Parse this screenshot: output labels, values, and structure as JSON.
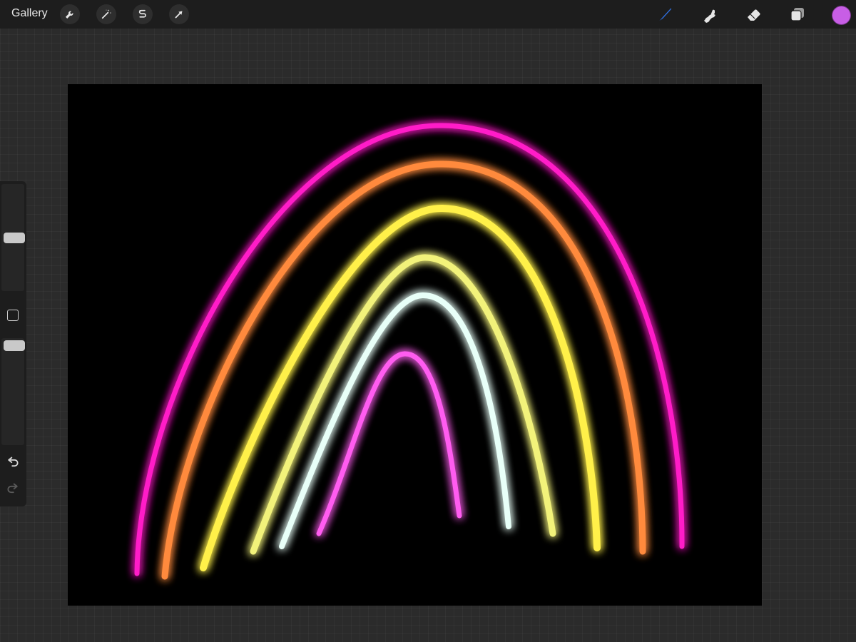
{
  "topbar": {
    "gallery_label": "Gallery",
    "left_tools": [
      "wrench-icon",
      "magic-wand-icon",
      "selection-s-icon",
      "transform-arrow-icon"
    ],
    "right_tools": [
      "brush-icon",
      "smudge-icon",
      "eraser-icon",
      "layers-icon"
    ],
    "active_tool": "brush",
    "accent_color": "#2f6fe0",
    "current_color": "#c85ee6"
  },
  "canvas": {
    "background": "#000000",
    "strokes": [
      {
        "name": "magenta-arc",
        "color": "#ff1fc8",
        "glow": "#ff2ad0"
      },
      {
        "name": "orange-arc",
        "color": "#ff8a3c",
        "glow": "#ff7a2a"
      },
      {
        "name": "yellow-arc",
        "color": "#fff04a",
        "glow": "#ffe22a"
      },
      {
        "name": "lime-arc",
        "color": "#f2f27a",
        "glow": "#d8f05a"
      },
      {
        "name": "cyan-arc",
        "color": "#e8fff8",
        "glow": "#7fffe6"
      },
      {
        "name": "pink-arc",
        "color": "#ff5cf0",
        "glow": "#ff3ae8"
      }
    ]
  },
  "sidebar": {
    "brush_size_level": 0.5,
    "opacity_level": 0.98,
    "tools": [
      "modify-square-icon",
      "undo-icon",
      "redo-icon"
    ]
  }
}
